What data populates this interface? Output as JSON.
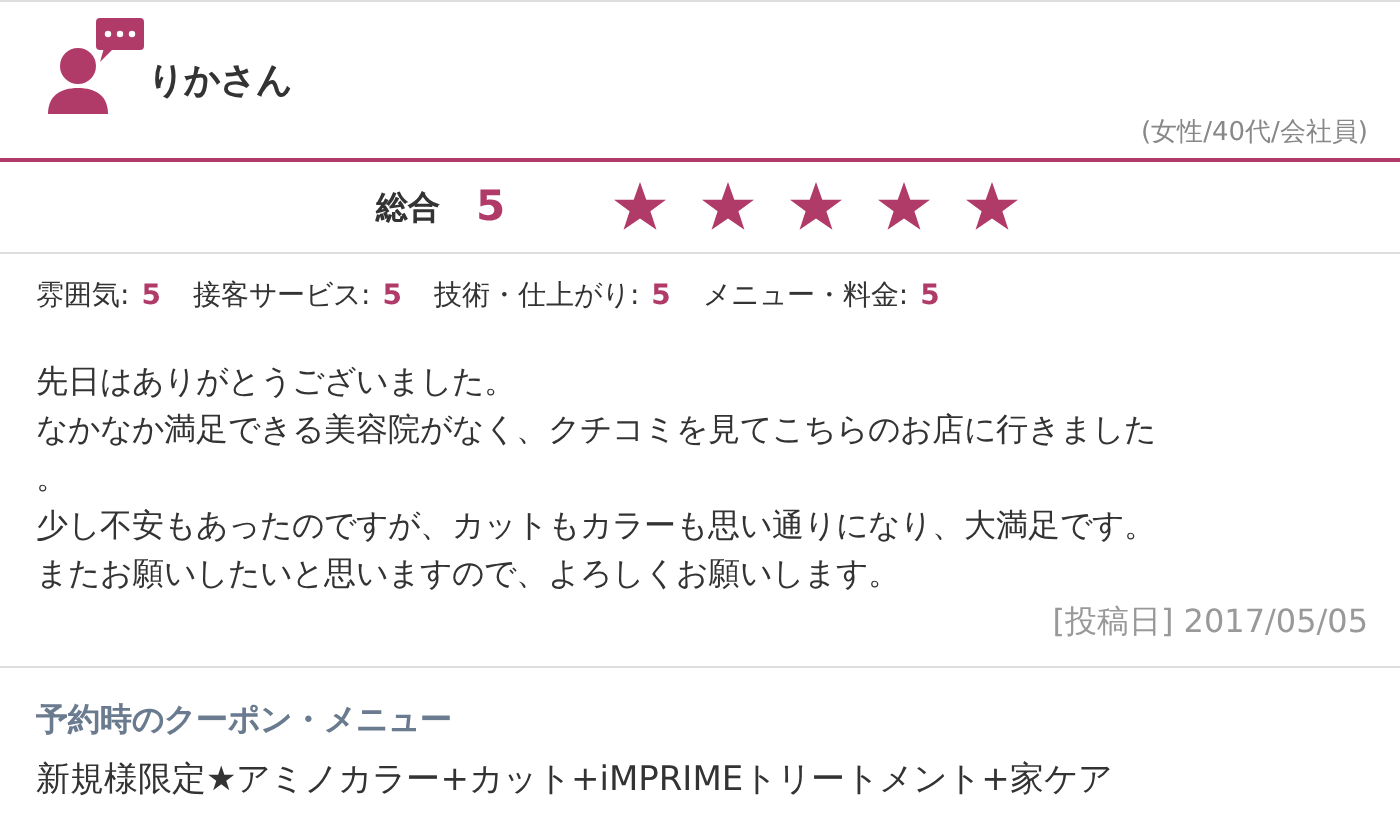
{
  "reviewer": {
    "name": "りかさん",
    "profile": "(女性/40代/会社員)"
  },
  "overall": {
    "label": "総合",
    "score": "5",
    "stars": 5
  },
  "ratings": [
    {
      "label": "雰囲気:",
      "score": "5"
    },
    {
      "label": "接客サービス:",
      "score": "5"
    },
    {
      "label": "技術・仕上がり:",
      "score": "5"
    },
    {
      "label": "メニュー・料金:",
      "score": "5"
    }
  ],
  "comment": [
    "先日はありがとうございました。",
    "なかなか満足できる美容院がなく、クチコミを見てこちらのお店に行きました",
    "。",
    "少し不安もあったのですが、カットもカラーも思い通りになり、大満足です。",
    "またお願いしたいと思いますので、よろしくお願いします。"
  ],
  "posted": "[投稿日] 2017/05/05",
  "coupon": {
    "heading": "予約時のクーポン・メニュー",
    "text": "新規様限定★アミノカラー+カット+iMPRIMEトリートメント+家ケア"
  }
}
